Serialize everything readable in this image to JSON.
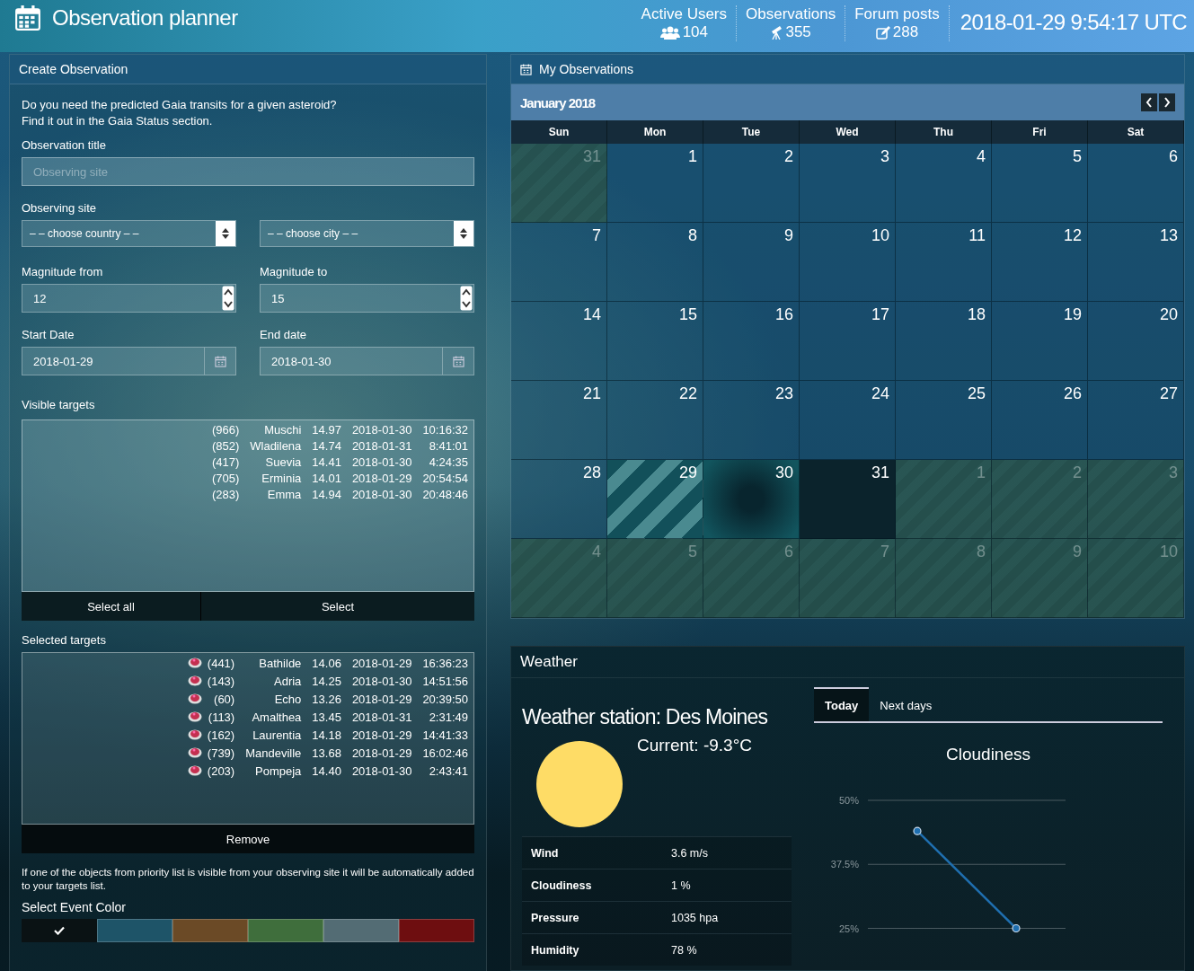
{
  "header": {
    "title": "Observation planner",
    "stats": [
      {
        "label": "Active Users",
        "value": "104",
        "kind": "users"
      },
      {
        "label": "Observations",
        "value": "355",
        "kind": "telescope"
      },
      {
        "label": "Forum posts",
        "value": "288",
        "kind": "edit"
      }
    ],
    "clock": "2018-01-29 9:54:17 UTC"
  },
  "create": {
    "title": "Create Observation",
    "intro": "Do you need the predicted Gaia transits for a given asteroid?\nFind it out in the Gaia Status section.",
    "obs_title": {
      "label": "Observation title",
      "placeholder": "Observing site"
    },
    "site": {
      "label": "Observing site",
      "country": "– – choose country – –",
      "city": "– – choose city – –"
    },
    "mag_from": {
      "label": "Magnitude from",
      "value": "12"
    },
    "mag_to": {
      "label": "Magnitude to",
      "value": "15"
    },
    "start": {
      "label": "Start Date",
      "value": "2018-01-29"
    },
    "end": {
      "label": "End date",
      "value": "2018-01-30"
    },
    "visible": {
      "label": "Visible targets",
      "rows": [
        [
          "(966)",
          "Muschi",
          "14.97",
          "2018-01-30",
          "10:16:32"
        ],
        [
          "(852)",
          "Wladilena",
          "14.74",
          "2018-01-31",
          "8:41:01"
        ],
        [
          "(417)",
          "Suevia",
          "14.41",
          "2018-01-30",
          "4:24:35"
        ],
        [
          "(705)",
          "Erminia",
          "14.01",
          "2018-01-29",
          "20:54:54"
        ],
        [
          "(283)",
          "Emma",
          "14.94",
          "2018-01-30",
          "20:48:46"
        ]
      ],
      "buttons": [
        "Select all",
        "Select"
      ]
    },
    "selected": {
      "label": "Selected targets",
      "rows": [
        [
          "(441)",
          "Bathilde",
          "14.06",
          "2018-01-29",
          "16:36:23"
        ],
        [
          "(143)",
          "Adria",
          "14.25",
          "2018-01-30",
          "14:51:56"
        ],
        [
          "(60)",
          "Echo",
          "13.26",
          "2018-01-29",
          "20:39:50"
        ],
        [
          "(113)",
          "Amalthea",
          "13.45",
          "2018-01-31",
          "2:31:49"
        ],
        [
          "(162)",
          "Laurentia",
          "14.18",
          "2018-01-29",
          "14:41:33"
        ],
        [
          "(739)",
          "Mandeville",
          "13.68",
          "2018-01-29",
          "16:02:46"
        ],
        [
          "(203)",
          "Pompeja",
          "14.40",
          "2018-01-30",
          "2:43:41"
        ]
      ],
      "button": "Remove"
    },
    "note": "If one of the objects from priority list is visible from your observing site it will be automatically added to your targets list.",
    "color_label": "Select Event Color",
    "colors": [
      {
        "color": "#0a1214",
        "selected": true
      },
      {
        "color": "#1e5468",
        "selected": false
      },
      {
        "color": "#6b4a26",
        "selected": false
      },
      {
        "color": "#3f6e3c",
        "selected": false
      },
      {
        "color": "#536c74",
        "selected": false
      },
      {
        "color": "#6e0e10",
        "selected": false
      }
    ]
  },
  "calendar": {
    "title": "My Observations",
    "month": "January 2018",
    "weekdays": [
      "Sun",
      "Mon",
      "Tue",
      "Wed",
      "Thu",
      "Fri",
      "Sat"
    ],
    "days": [
      {
        "n": "31",
        "kind": "other"
      },
      {
        "n": "1",
        "kind": "day"
      },
      {
        "n": "2",
        "kind": "day"
      },
      {
        "n": "3",
        "kind": "day"
      },
      {
        "n": "4",
        "kind": "day"
      },
      {
        "n": "5",
        "kind": "day"
      },
      {
        "n": "6",
        "kind": "day"
      },
      {
        "n": "7",
        "kind": "day"
      },
      {
        "n": "8",
        "kind": "day"
      },
      {
        "n": "9",
        "kind": "day"
      },
      {
        "n": "10",
        "kind": "day"
      },
      {
        "n": "11",
        "kind": "day"
      },
      {
        "n": "12",
        "kind": "day"
      },
      {
        "n": "13",
        "kind": "day"
      },
      {
        "n": "14",
        "kind": "day"
      },
      {
        "n": "15",
        "kind": "day"
      },
      {
        "n": "16",
        "kind": "day"
      },
      {
        "n": "17",
        "kind": "day"
      },
      {
        "n": "18",
        "kind": "day"
      },
      {
        "n": "19",
        "kind": "day"
      },
      {
        "n": "20",
        "kind": "day"
      },
      {
        "n": "21",
        "kind": "day"
      },
      {
        "n": "22",
        "kind": "day"
      },
      {
        "n": "23",
        "kind": "day"
      },
      {
        "n": "24",
        "kind": "day"
      },
      {
        "n": "25",
        "kind": "day"
      },
      {
        "n": "26",
        "kind": "day"
      },
      {
        "n": "27",
        "kind": "day"
      },
      {
        "n": "28",
        "kind": "day"
      },
      {
        "n": "29",
        "kind": "today"
      },
      {
        "n": "30",
        "kind": "glow"
      },
      {
        "n": "31",
        "kind": "dark"
      },
      {
        "n": "1",
        "kind": "other"
      },
      {
        "n": "2",
        "kind": "other"
      },
      {
        "n": "3",
        "kind": "other"
      },
      {
        "n": "4",
        "kind": "other"
      },
      {
        "n": "5",
        "kind": "other"
      },
      {
        "n": "6",
        "kind": "other"
      },
      {
        "n": "7",
        "kind": "other"
      },
      {
        "n": "8",
        "kind": "other"
      },
      {
        "n": "9",
        "kind": "other"
      },
      {
        "n": "10",
        "kind": "other"
      }
    ]
  },
  "weather": {
    "title": "Weather",
    "station": "Weather station: Des Moines",
    "current": "Current: -9.3°C",
    "tabs": [
      {
        "label": "Today",
        "selected": true
      },
      {
        "label": "Next days",
        "selected": false
      }
    ],
    "details": [
      [
        "Wind",
        "3.6 m/s"
      ],
      [
        "Cloudiness",
        "1 %"
      ],
      [
        "Pressure",
        "1035 hpa"
      ],
      [
        "Humidity",
        "78 %"
      ]
    ],
    "chart_data": {
      "type": "line",
      "title": "Cloudiness",
      "values": [
        44,
        25
      ],
      "marker": true,
      "ylim": [
        25,
        50
      ],
      "yticks": [
        {
          "value": 25,
          "label": "25%"
        },
        {
          "value": 37.5,
          "label": "37.5%"
        },
        {
          "value": 50,
          "label": "50%"
        }
      ]
    }
  }
}
